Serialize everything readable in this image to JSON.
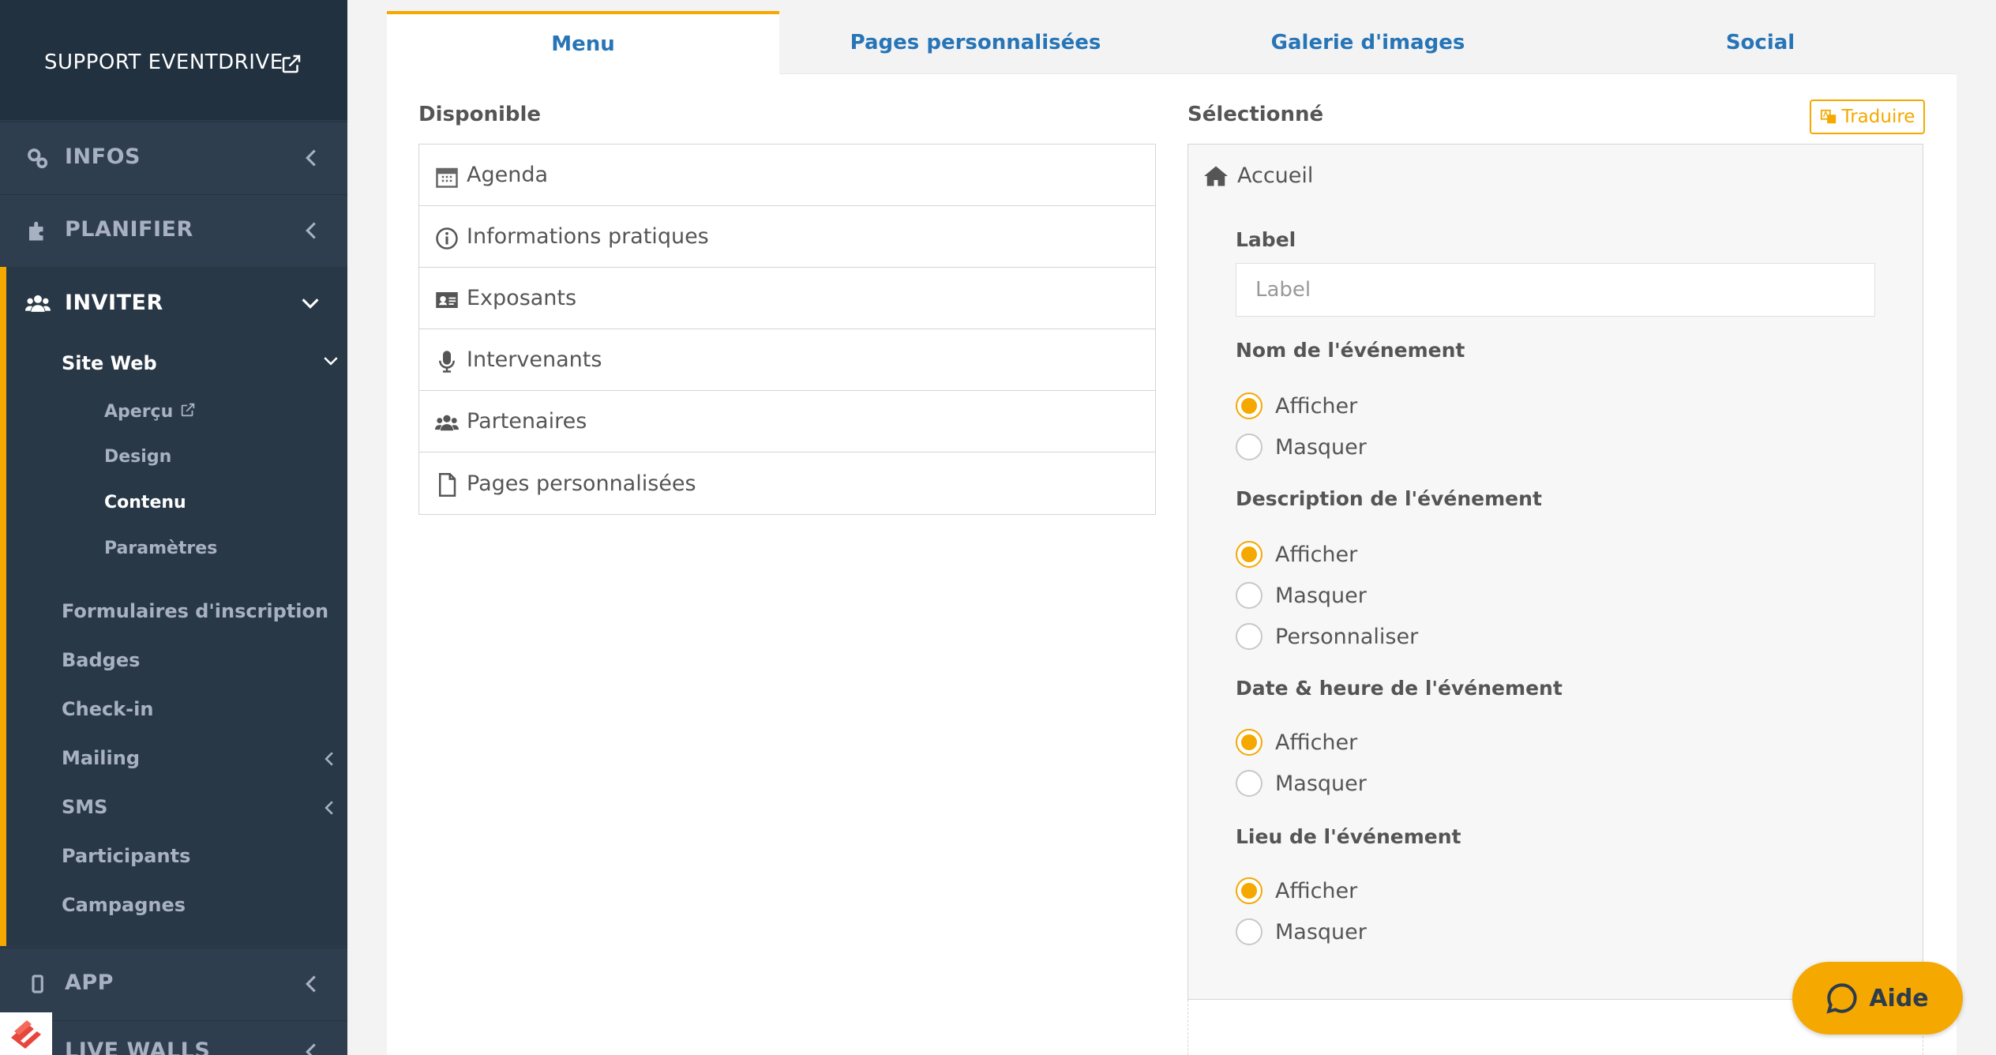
{
  "sidebar": {
    "support_label": "SUPPORT EVENTDRIVE",
    "nav": {
      "infos": "INFOS",
      "planifier": "PLANIFIER",
      "inviter": "INVITER",
      "app": "APP",
      "live_walls": "LIVE WALLS"
    },
    "site_web": "Site Web",
    "site_web_items": {
      "apercu": "Aperçu",
      "design": "Design",
      "contenu": "Contenu",
      "parametres": "Paramètres"
    },
    "inviter_items": {
      "formulaires": "Formulaires d'inscription",
      "badges": "Badges",
      "checkin": "Check-in",
      "mailing": "Mailing",
      "sms": "SMS",
      "participants": "Participants",
      "campagnes": "Campagnes"
    }
  },
  "tabs": [
    "Menu",
    "Pages personnalisées",
    "Galerie d'images",
    "Social"
  ],
  "available": {
    "title": "Disponible",
    "items": [
      "Agenda",
      "Informations pratiques",
      "Exposants",
      "Intervenants",
      "Partenaires",
      "Pages personnalisées"
    ]
  },
  "selected": {
    "title": "Sélectionné",
    "translate_label": "Traduire",
    "item_title": "Accueil",
    "label_field": {
      "label": "Label",
      "placeholder": "Label"
    },
    "groups": {
      "nom": {
        "label": "Nom de l'événement",
        "afficher": "Afficher",
        "masquer": "Masquer"
      },
      "description": {
        "label": "Description de l'événement",
        "afficher": "Afficher",
        "masquer": "Masquer",
        "personnaliser": "Personnaliser"
      },
      "date": {
        "label": "Date & heure de l'événement",
        "afficher": "Afficher",
        "masquer": "Masquer"
      },
      "lieu": {
        "label": "Lieu de l'événement",
        "afficher": "Afficher",
        "masquer": "Masquer"
      }
    }
  },
  "help_button": "Aide",
  "colors": {
    "accent": "#f5a800",
    "link": "#2775b6",
    "sidebar": "#2d3b4c"
  }
}
